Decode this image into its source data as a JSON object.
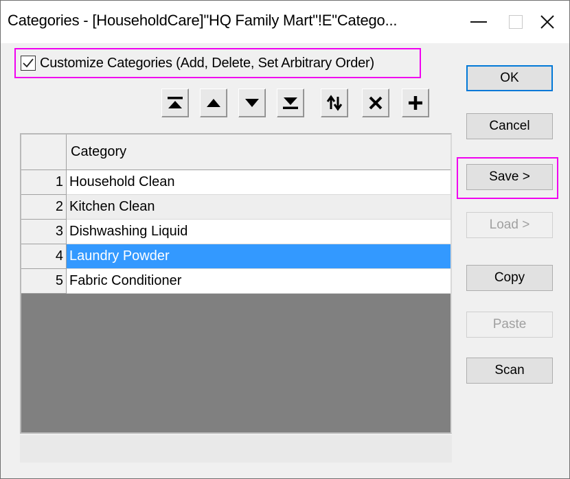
{
  "window": {
    "title": "Categories - [HouseholdCare]\"HQ Family Mart\"!E\"Catego..."
  },
  "options": {
    "customize_label": "Customize Categories (Add, Delete, Set Arbitrary Order)",
    "customize_checked": true
  },
  "toolbar": {
    "icons": [
      "move-to-top-icon",
      "move-up-icon",
      "move-down-icon",
      "move-to-bottom-icon",
      "sort-icon",
      "delete-icon",
      "add-icon"
    ]
  },
  "table": {
    "header": "Category",
    "rows": [
      {
        "num": "1",
        "category": "Household Clean"
      },
      {
        "num": "2",
        "category": "Kitchen Clean"
      },
      {
        "num": "3",
        "category": "Dishwashing Liquid"
      },
      {
        "num": "4",
        "category": "Laundry Powder"
      },
      {
        "num": "5",
        "category": "Fabric Conditioner"
      }
    ],
    "selected_row": 4
  },
  "buttons": {
    "ok": "OK",
    "cancel": "Cancel",
    "save": "Save >",
    "load": "Load >",
    "copy": "Copy",
    "paste": "Paste",
    "scan": "Scan"
  },
  "colors": {
    "selection": "#3399ff",
    "highlight": "#f000f0",
    "default_button_border": "#0078d7"
  }
}
